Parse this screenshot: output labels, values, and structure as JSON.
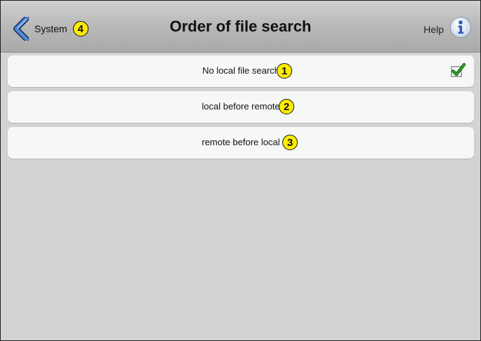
{
  "header": {
    "back_label": "System",
    "back_badge": "4",
    "title": "Order of file search",
    "help_label": "Help"
  },
  "options": [
    {
      "label": "No local file search",
      "badge": "1",
      "selected": true
    },
    {
      "label": "local before remote",
      "badge": "2",
      "selected": false
    },
    {
      "label": "remote before local",
      "badge": "3",
      "selected": false
    }
  ],
  "colors": {
    "accent": "#3a73c9",
    "badge_fill": "#ffed00",
    "check": "#2e9a2e",
    "row_bg": "#f6f7f7",
    "page_bg": "#d3d3d3"
  },
  "icons": {
    "back": "chevron-left-icon",
    "help": "info-icon",
    "selected": "checkmark-icon"
  }
}
